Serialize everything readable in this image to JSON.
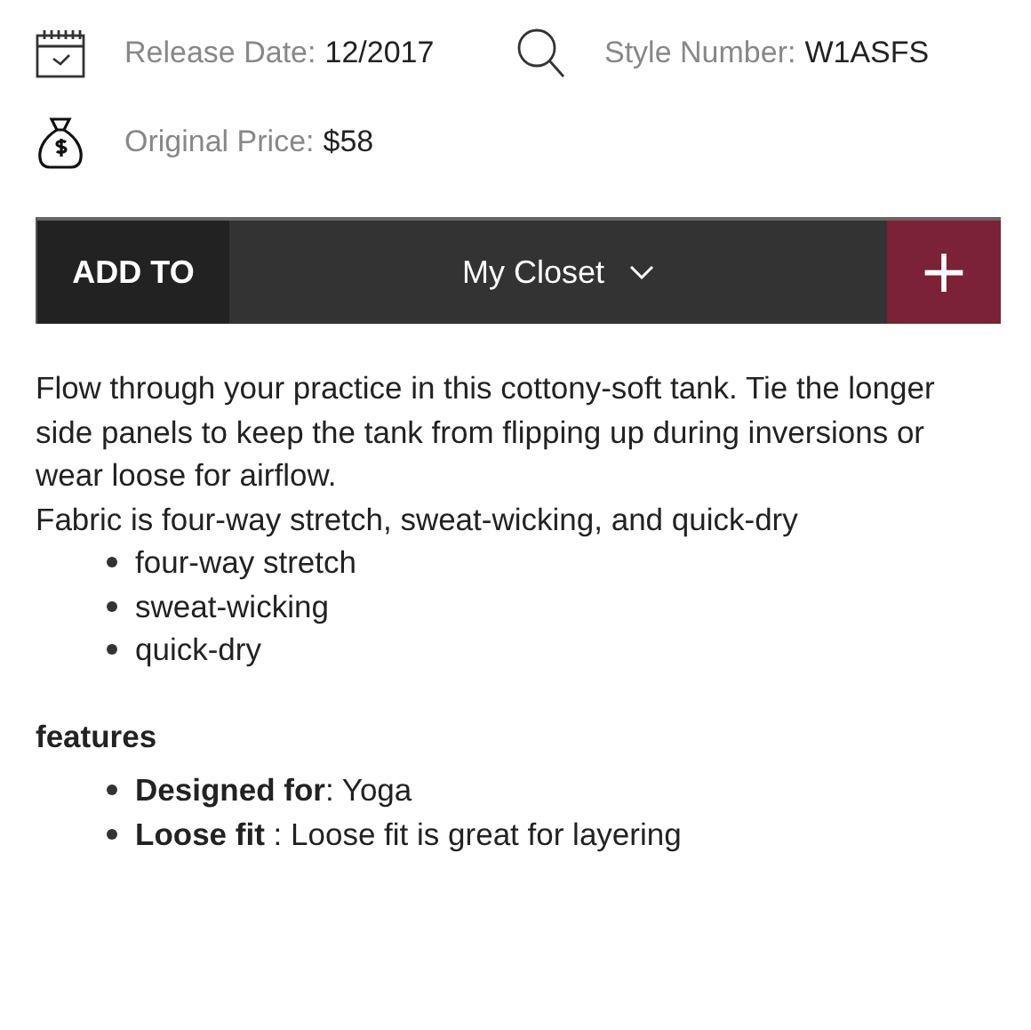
{
  "details": [
    {
      "kind": "calendar",
      "label": "Release Date:",
      "value": "12/2017"
    },
    {
      "kind": "search",
      "label": "Style Number:",
      "value": "W1ASFS"
    },
    {
      "kind": "money",
      "label": "Original Price:",
      "value": "$58"
    }
  ],
  "add_bar": {
    "label": "ADD TO",
    "dropdown": "My Closet",
    "add_symbol": "+"
  },
  "description": [
    "Flow through your practice in this cottony-soft tank. Tie the longer side panels to keep the tank from flipping up during inversions or wear loose for airflow.",
    "Fabric is four-way stretch, sweat-wicking, and quick-dry"
  ],
  "fabric_list": [
    "four-way stretch",
    "sweat-wicking",
    "quick-dry"
  ],
  "features_heading": "features",
  "features": [
    "**Designed for**: Yoga",
    "**Loose fit** : Loose fit is great for layering"
  ]
}
